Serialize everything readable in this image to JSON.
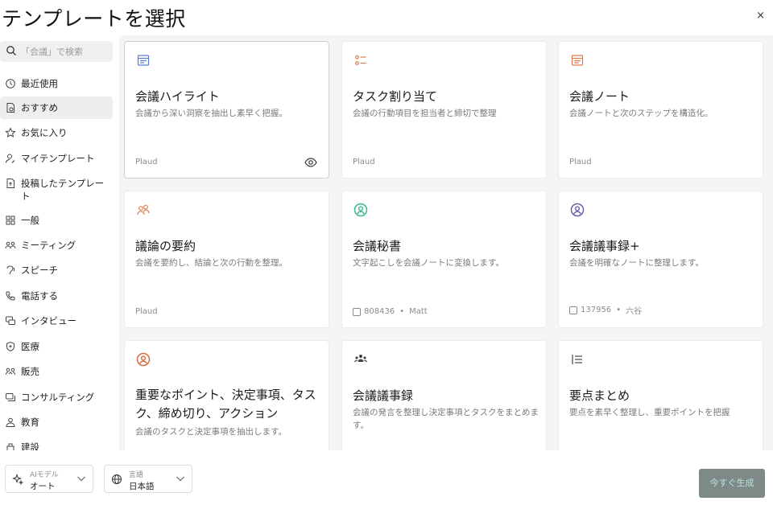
{
  "dialog": {
    "title": "テンプレートを選択",
    "close": "×"
  },
  "search": {
    "placeholder": "「会議」で検索"
  },
  "sidebar": {
    "items": [
      {
        "label": "最近使用",
        "icon": "clock-icon"
      },
      {
        "label": "おすすめ",
        "icon": "document-star-icon",
        "active": true
      },
      {
        "label": "お気に入り",
        "icon": "star-icon"
      },
      {
        "label": "マイテンプレート",
        "icon": "user-edit-icon"
      },
      {
        "label": "投稿したテンプレート",
        "icon": "document-upload-icon"
      },
      {
        "label": "一般",
        "icon": "grid-icon"
      },
      {
        "label": "ミーティング",
        "icon": "people-icon"
      },
      {
        "label": "スピーチ",
        "icon": "speech-icon"
      },
      {
        "label": "電話する",
        "icon": "phone-icon"
      },
      {
        "label": "インタビュー",
        "icon": "interview-icon"
      },
      {
        "label": "医療",
        "icon": "shield-medical-icon"
      },
      {
        "label": "販売",
        "icon": "sales-icon"
      },
      {
        "label": "コンサルティング",
        "icon": "consulting-icon"
      },
      {
        "label": "教育",
        "icon": "education-icon"
      },
      {
        "label": "建設",
        "icon": "construction-icon"
      }
    ]
  },
  "cards": [
    {
      "name": "会議ハイライト",
      "desc": "会議から深い洞察を抽出し素早く把握。",
      "author": "Plaud",
      "icon": "highlight-doc-icon",
      "color": "#5b7bd5",
      "selected": true
    },
    {
      "name": "タスク割り当て",
      "desc": "会議の行動項目を担当者と締切で整理",
      "author": "Plaud",
      "icon": "task-list-icon",
      "color": "#e07b4f"
    },
    {
      "name": "会議ノート",
      "desc": "会議ノートと次のステップを構造化。",
      "author": "Plaud",
      "icon": "note-icon",
      "color": "#e07b4f"
    },
    {
      "name": "議論の要約",
      "desc": "会議を要約し、結論と次の行動を整理。",
      "author": "Plaud",
      "icon": "people-orange-icon",
      "color": "#e07b4f"
    },
    {
      "name": "会議秘書",
      "desc": "文字起こしを会議ノートに変換します。",
      "count": "808436",
      "author": "Matt",
      "icon": "user-circle-icon",
      "color": "#3fb58f"
    },
    {
      "name": "会議議事録+",
      "desc": "会議を明確なノートに整理します。",
      "count": "137956",
      "author": "六谷",
      "icon": "user-circle-purple-icon",
      "color": "#6a5fa8"
    },
    {
      "name": "重要なポイント、決定事項、タスク、締め切り、アクション",
      "desc": "会議のタスクと決定事項を抽出します。",
      "icon": "user-circle-orange-icon",
      "color": "#d76b3f"
    },
    {
      "name": "会議議事録",
      "desc": "会議の発言を整理し決定事項とタスクをまとめます。",
      "icon": "group-icon",
      "color": "#444444"
    },
    {
      "name": "要点まとめ",
      "desc": "要点を素早く整理し、重要ポイントを把握",
      "icon": "list-icon",
      "color": "#555555"
    }
  ],
  "footer": {
    "model": {
      "label": "AIモデル",
      "value": "オート"
    },
    "language": {
      "label": "言語",
      "value": "日本語"
    },
    "generate": "今すぐ生成"
  },
  "meta_sep": "•"
}
